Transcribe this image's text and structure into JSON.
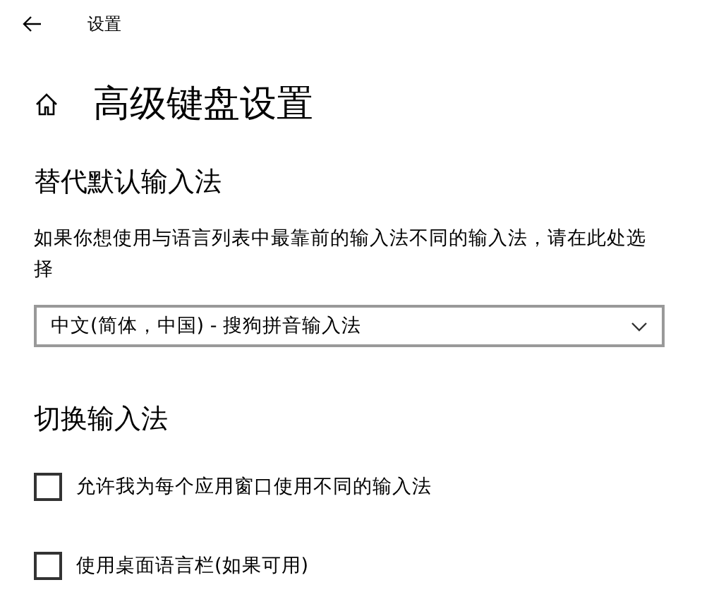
{
  "window": {
    "title": "设置"
  },
  "page": {
    "heading": "高级键盘设置"
  },
  "override": {
    "heading": "替代默认输入法",
    "description": "如果你想使用与语言列表中最靠前的输入法不同的输入法，请在此处选择",
    "dropdown": {
      "value": "中文(简体，中国) - 搜狗拼音输入法"
    }
  },
  "switching": {
    "heading": "切换输入法",
    "options": [
      {
        "label": "允许我为每个应用窗口使用不同的输入法",
        "checked": false
      },
      {
        "label": "使用桌面语言栏(如果可用)",
        "checked": false
      }
    ]
  }
}
